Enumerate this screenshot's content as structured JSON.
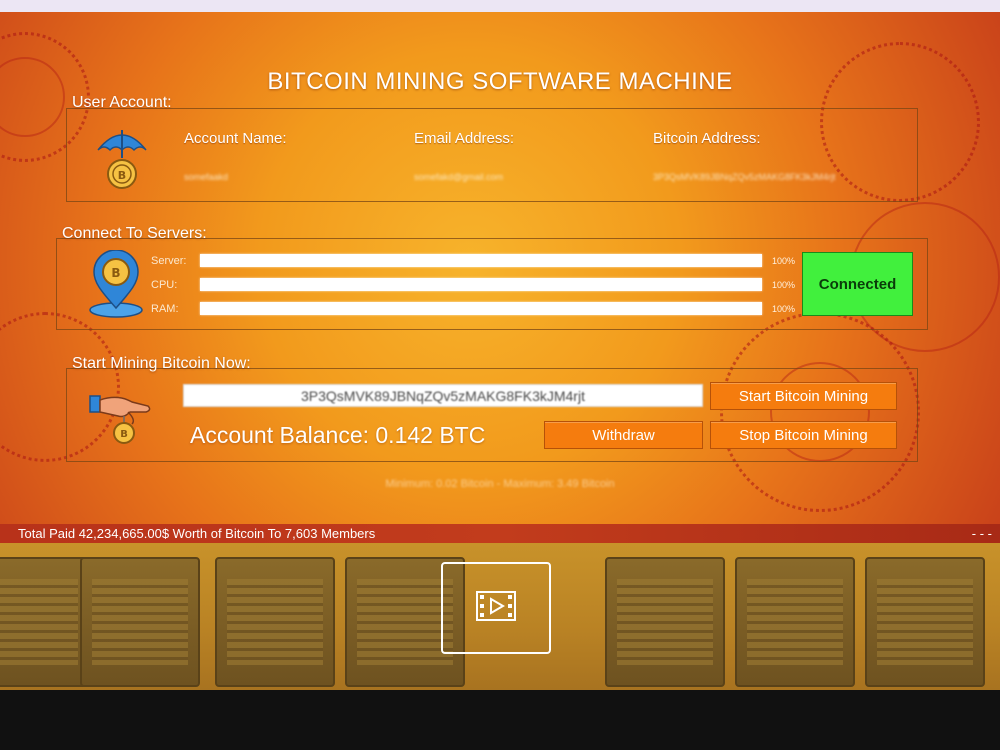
{
  "app": {
    "title": "BITCOIN MINING SOFTWARE MACHINE"
  },
  "user_account": {
    "label": "User Account:",
    "account_name_label": "Account Name:",
    "email_label": "Email Address:",
    "bitcoin_label": "Bitcoin Address:",
    "account_name_value": "somefaakd",
    "email_value": "somefakd@gmail.com",
    "bitcoin_value": "3P3QsMVK89JBNqZQv5zMAKG8FK3kJM4rjt"
  },
  "servers": {
    "label": "Connect To Servers:",
    "rows": [
      {
        "label": "Server:",
        "percent_label": "100%",
        "progress": 1.0
      },
      {
        "label": "CPU:",
        "percent_label": "100%",
        "progress": 1.0
      },
      {
        "label": "RAM:",
        "percent_label": "100%",
        "progress": 1.0
      }
    ],
    "status": "Connected",
    "status_color": "#41f03d"
  },
  "mining": {
    "label": "Start Mining Bitcoin Now:",
    "address_value": "3P3QsMVK89JBNqZQv5zMAKG8FK3kJM4rjt",
    "balance": "Account Balance: 0.142 BTC",
    "withdraw_label": "Withdraw",
    "start_label": "Start Bitcoin Mining",
    "stop_label": "Stop Bitcoin Mining",
    "limits": "Minimum: 0.02 Bitcoin - Maximum: 3.49 Bitcoin",
    "button_color": "#f57c0e"
  },
  "ticker": {
    "text": "Total Paid 42,234,665.00$ Worth of Bitcoin To 7,603 Members",
    "dashes": "- - -"
  },
  "video": {
    "icon": "film-play-icon"
  },
  "colors": {
    "accent": "#f29a1c",
    "ticker_bg": "#c23c1c"
  }
}
